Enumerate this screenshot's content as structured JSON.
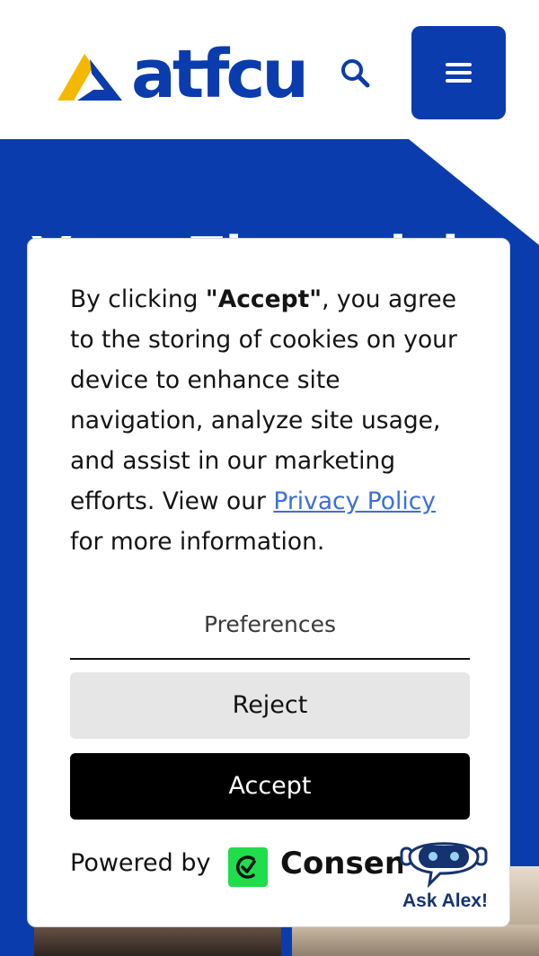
{
  "brand": {
    "name": "atfcu",
    "primary_color": "#0a3cad",
    "accent_color": "#f5b800"
  },
  "header": {
    "search_icon": "search-icon",
    "menu_icon": "hamburger-menu-icon"
  },
  "hero": {
    "title": "Your Financial"
  },
  "cookie_banner": {
    "text_before": "By clicking ",
    "text_bold": "\"Accept\"",
    "text_mid": ", you agree to the storing of cookies on your device to enhance site navigation, analyze site usage, and assist in our marketing efforts. View our ",
    "privacy_link": "Privacy Policy",
    "text_after": " for more information.",
    "preferences_label": "Preferences",
    "reject_label": "Reject",
    "accept_label": "Accept",
    "powered_by_label": "Powered by",
    "provider_name": "Consent",
    "provider_color": "#1fdd4b"
  },
  "chatbot": {
    "label": "Ask Alex!",
    "icon": "robot-icon"
  }
}
